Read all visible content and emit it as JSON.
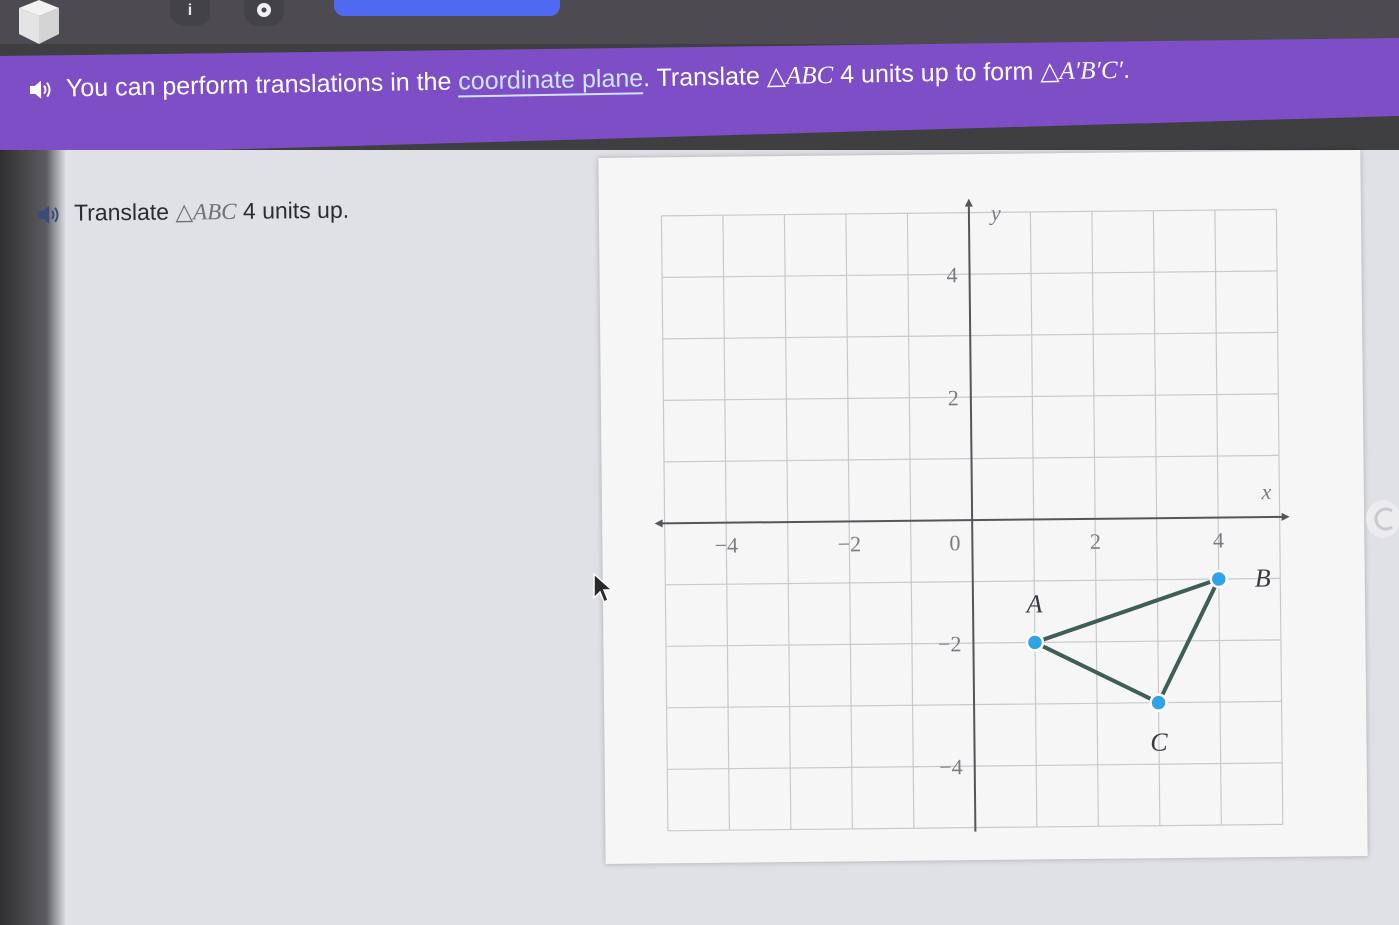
{
  "toolbar": {
    "info_label": "i",
    "icons": [
      "cube-icon",
      "info-icon",
      "gear-icon",
      "speaker-icon",
      "reset-icon",
      "cursor-icon"
    ]
  },
  "banner": {
    "part1": "You can perform translations in the ",
    "link": "coordinate plane",
    "part2": ". Translate ",
    "tri1": "△ABC",
    "part3": " 4 units up to form ",
    "tri2": "△A′B′C′",
    "part4": "."
  },
  "problem": {
    "part1": "Translate ",
    "tri": "△ABC",
    "part2": " 4 units up."
  },
  "colors": {
    "banner": "#7e4ec7",
    "link": "#cfe4ff",
    "point": "#2fa3e6",
    "segment": "#3f5e58",
    "progress": "#4f6af0"
  },
  "chart_data": {
    "type": "scatter",
    "xlim": [
      -5,
      5
    ],
    "ylim": [
      -5,
      5
    ],
    "grid": true,
    "x_ticks": [
      -4,
      -2,
      2,
      4
    ],
    "y_ticks": [
      4,
      2,
      -2,
      -4
    ],
    "origin_label": "0",
    "xlabel": "x",
    "ylabel": "y",
    "points": [
      {
        "label": "A",
        "x": 1,
        "y": -2
      },
      {
        "label": "B",
        "x": 4,
        "y": -1
      },
      {
        "label": "C",
        "x": 3,
        "y": -3
      }
    ],
    "segments": [
      [
        "A",
        "B"
      ],
      [
        "B",
        "C"
      ],
      [
        "C",
        "A"
      ]
    ]
  }
}
